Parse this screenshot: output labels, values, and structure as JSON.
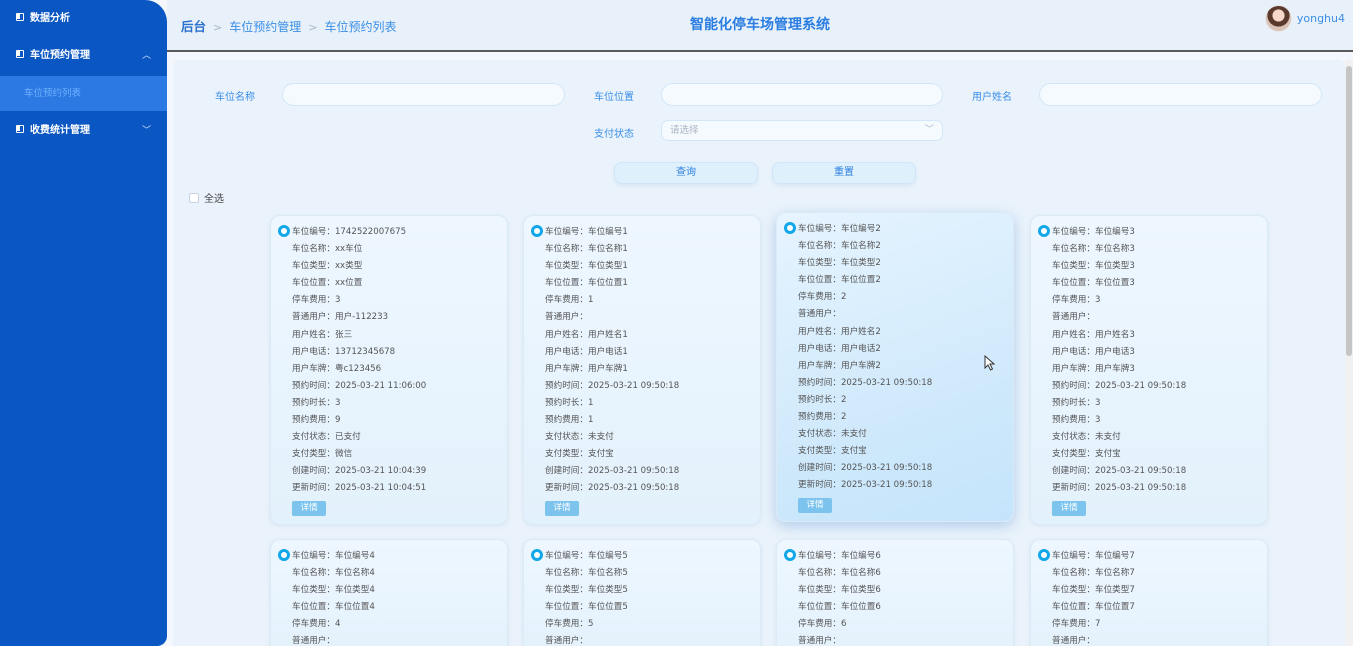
{
  "sidebar": {
    "items": [
      {
        "label": "数据分析",
        "arrow": ""
      },
      {
        "label": "车位预约管理",
        "arrow": "︿"
      },
      {
        "label": "收费统计管理",
        "arrow": "﹀"
      }
    ],
    "active_sub": "车位预约列表"
  },
  "header": {
    "breadcrumb": [
      "后台",
      "车位预约管理",
      "车位预约列表"
    ],
    "separator": ">",
    "title": "智能化停车场管理系统",
    "username": "yonghu4"
  },
  "search": {
    "space_name_label": "车位名称",
    "space_location_label": "车位位置",
    "user_name_label": "用户姓名",
    "pay_status_label": "支付状态",
    "pay_status_placeholder": "请选择",
    "query_label": "查询",
    "reset_label": "重置",
    "select_all_label": "全选"
  },
  "detail_label": "详情",
  "cards": [
    {
      "lines": [
        "车位编号：1742522007675",
        "车位名称：xx车位",
        "车位类型：xx类型",
        "车位位置：xx位置",
        "停车费用：3",
        "普通用户：用户-112233",
        "用户姓名：张三",
        "用户电话：13712345678",
        "用户车牌：粤c123456",
        "预约时间：2025-03-21 11:06:00",
        "预约时长：3",
        "预约费用：9",
        "支付状态：已支付",
        "支付类型：微信",
        "创建时间：2025-03-21 10:04:39",
        "更新时间：2025-03-21 10:04:51"
      ]
    },
    {
      "lines": [
        "车位编号：车位编号1",
        "车位名称：车位名称1",
        "车位类型：车位类型1",
        "车位位置：车位位置1",
        "停车费用：1",
        "普通用户：",
        "用户姓名：用户姓名1",
        "用户电话：用户电话1",
        "用户车牌：用户车牌1",
        "预约时间：2025-03-21 09:50:18",
        "预约时长：1",
        "预约费用：1",
        "支付状态：未支付",
        "支付类型：支付宝",
        "创建时间：2025-03-21 09:50:18",
        "更新时间：2025-03-21 09:50:18"
      ]
    },
    {
      "lines": [
        "车位编号：车位编号2",
        "车位名称：车位名称2",
        "车位类型：车位类型2",
        "车位位置：车位位置2",
        "停车费用：2",
        "普通用户：",
        "用户姓名：用户姓名2",
        "用户电话：用户电话2",
        "用户车牌：用户车牌2",
        "预约时间：2025-03-21 09:50:18",
        "预约时长：2",
        "预约费用：2",
        "支付状态：未支付",
        "支付类型：支付宝",
        "创建时间：2025-03-21 09:50:18",
        "更新时间：2025-03-21 09:50:18"
      ]
    },
    {
      "lines": [
        "车位编号：车位编号3",
        "车位名称：车位名称3",
        "车位类型：车位类型3",
        "车位位置：车位位置3",
        "停车费用：3",
        "普通用户：",
        "用户姓名：用户姓名3",
        "用户电话：用户电话3",
        "用户车牌：用户车牌3",
        "预约时间：2025-03-21 09:50:18",
        "预约时长：3",
        "预约费用：3",
        "支付状态：未支付",
        "支付类型：支付宝",
        "创建时间：2025-03-21 09:50:18",
        "更新时间：2025-03-21 09:50:18"
      ]
    },
    {
      "lines": [
        "车位编号：车位编号4",
        "车位名称：车位名称4",
        "车位类型：车位类型4",
        "车位位置：车位位置4",
        "停车费用：4",
        "普通用户："
      ]
    },
    {
      "lines": [
        "车位编号：车位编号5",
        "车位名称：车位名称5",
        "车位类型：车位类型5",
        "车位位置：车位位置5",
        "停车费用：5",
        "普通用户："
      ]
    },
    {
      "lines": [
        "车位编号：车位编号6",
        "车位名称：车位名称6",
        "车位类型：车位类型6",
        "车位位置：车位位置6",
        "停车费用：6",
        "普通用户："
      ]
    },
    {
      "lines": [
        "车位编号：车位编号7",
        "车位名称：车位名称7",
        "车位类型：车位类型7",
        "车位位置：车位位置7",
        "停车费用：7",
        "普通用户："
      ]
    }
  ],
  "colors": {
    "sidebar_bg": "#0a56c2",
    "accent": "#2a7de1",
    "card_radio": "#12a7e8",
    "detail_button": "#7cc3ee"
  }
}
